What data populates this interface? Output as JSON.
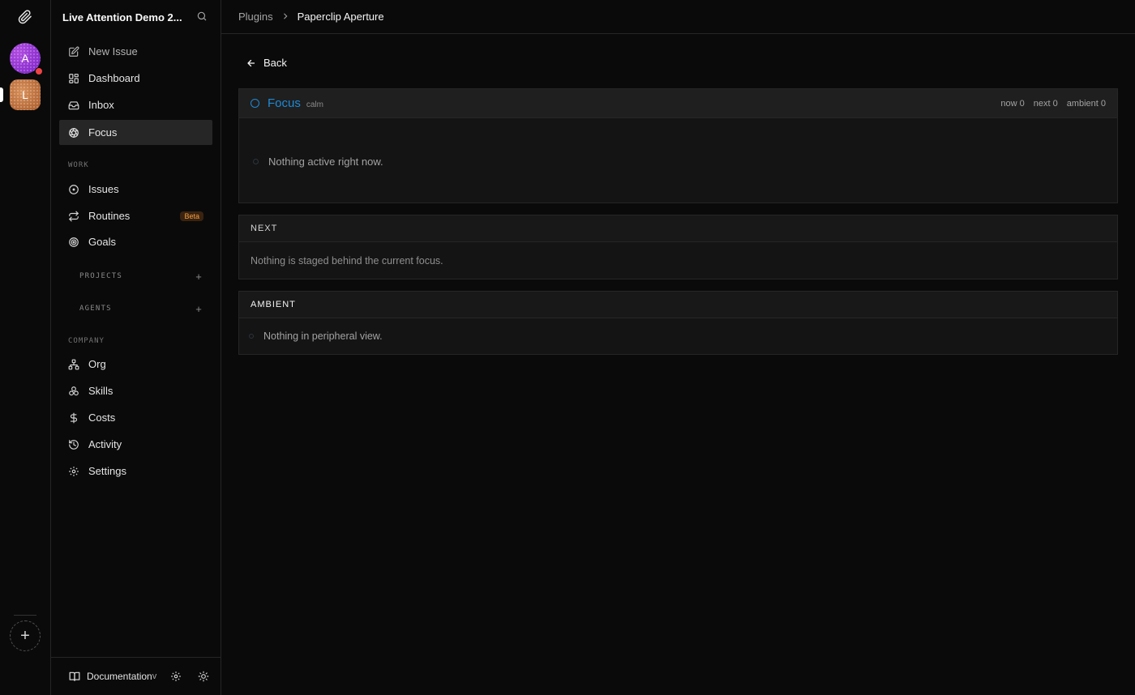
{
  "rail": {
    "avatars": [
      {
        "initial": "A",
        "color": "#8b3ad6"
      },
      {
        "initial": "L",
        "color": "#c07a45"
      }
    ],
    "add_label": "+"
  },
  "sidebar": {
    "company_name": "Live Attention Demo 2...",
    "top_items": [
      {
        "label": "New Issue",
        "icon": "pencil-square-icon"
      },
      {
        "label": "Dashboard",
        "icon": "layout-grid-icon"
      },
      {
        "label": "Inbox",
        "icon": "inbox-icon"
      },
      {
        "label": "Focus",
        "icon": "aperture-icon",
        "active": true
      }
    ],
    "work_label": "WORK",
    "work_items": [
      {
        "label": "Issues",
        "icon": "circle-dot-icon"
      },
      {
        "label": "Routines",
        "icon": "repeat-icon",
        "badge": "Beta"
      },
      {
        "label": "Goals",
        "icon": "target-icon"
      }
    ],
    "projects_label": "PROJECTS",
    "agents_label": "AGENTS",
    "company_label": "COMPANY",
    "company_items": [
      {
        "label": "Org",
        "icon": "org-chart-icon"
      },
      {
        "label": "Skills",
        "icon": "boxes-icon"
      },
      {
        "label": "Costs",
        "icon": "dollar-icon"
      },
      {
        "label": "Activity",
        "icon": "history-icon"
      },
      {
        "label": "Settings",
        "icon": "gear-icon"
      }
    ],
    "footer": {
      "docs_label": "Documentation",
      "version": "v"
    }
  },
  "breadcrumb": {
    "parent": "Plugins",
    "current": "Paperclip Aperture"
  },
  "back_label": "Back",
  "focus": {
    "title": "Focus",
    "mode": "calm",
    "stats": {
      "now": "now 0",
      "next": "next 0",
      "ambient": "ambient 0"
    },
    "empty_text": "Nothing active right now.",
    "accent": "#1e8ad6"
  },
  "next_section": {
    "heading": "NEXT",
    "empty_text": "Nothing is staged behind the current focus."
  },
  "ambient_section": {
    "heading": "AMBIENT",
    "empty_text": "Nothing in peripheral view."
  }
}
